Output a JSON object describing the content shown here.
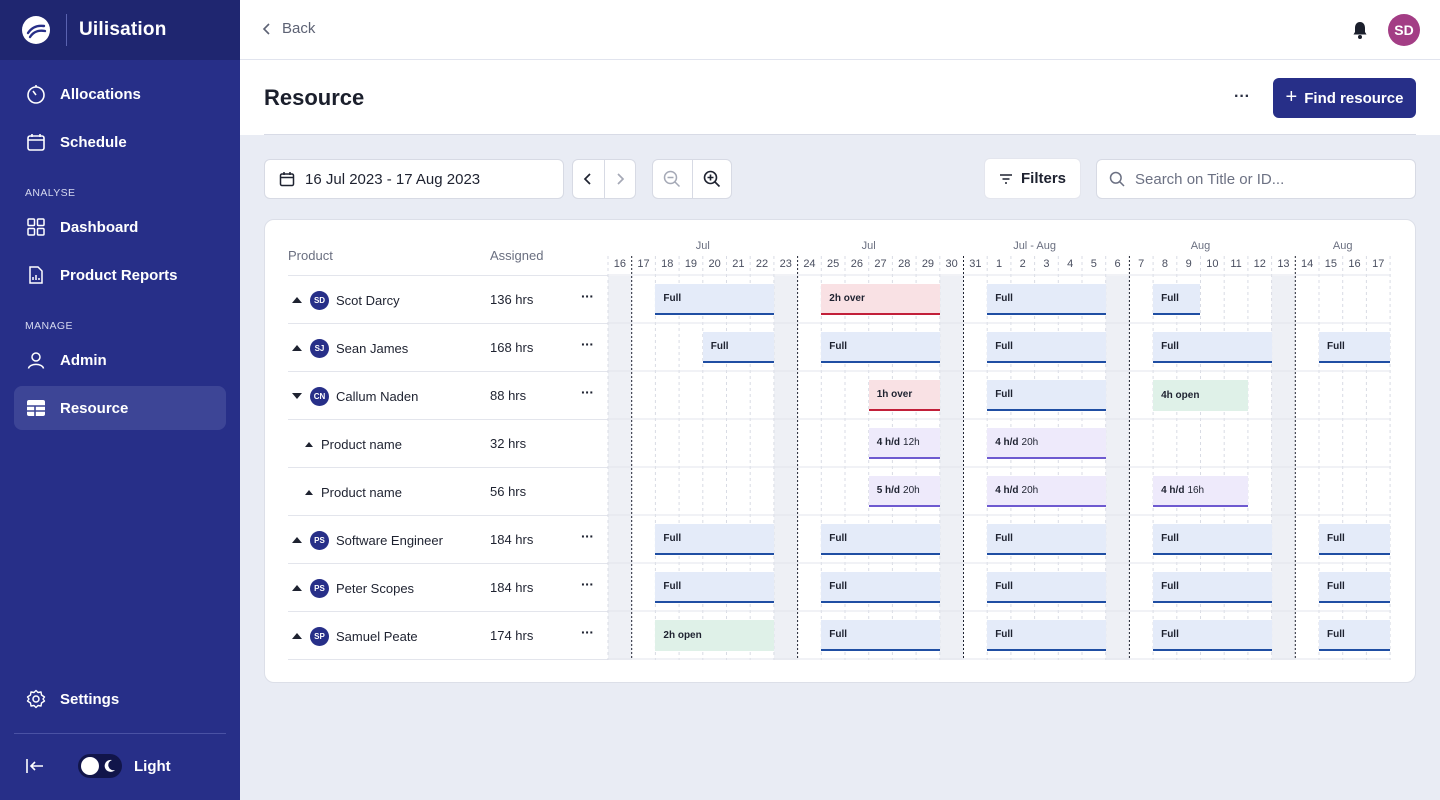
{
  "app": {
    "name": "Uilisation"
  },
  "sidebar": {
    "items_top": [
      {
        "label": "Allocations",
        "icon": "timer-icon"
      },
      {
        "label": "Schedule",
        "icon": "calendar-icon"
      }
    ],
    "section_analyse": "ANALYSE",
    "items_analyse": [
      {
        "label": "Dashboard",
        "icon": "grid-icon"
      },
      {
        "label": "Product Reports",
        "icon": "report-icon"
      }
    ],
    "section_manage": "MANAGE",
    "items_manage": [
      {
        "label": "Admin",
        "icon": "user-icon"
      },
      {
        "label": "Resource",
        "icon": "table-icon",
        "active": true
      }
    ],
    "settings": "Settings",
    "theme_label": "Light"
  },
  "topbar": {
    "back_label": "Back",
    "avatar_initials": "SD"
  },
  "header": {
    "title": "Resource",
    "more": "···",
    "find_button": "Find resource",
    "find_plus": "+"
  },
  "toolbar": {
    "date_range": "16 Jul 2023 - 17 Aug 2023",
    "filters_label": "Filters",
    "search_placeholder": "Search on Title or ID..."
  },
  "table": {
    "col_product": "Product",
    "col_assigned": "Assigned",
    "row_menu": "···",
    "rows": [
      {
        "name": "Scot Darcy",
        "initials": "SD",
        "hours": "136 hrs",
        "type": "person",
        "caret": "up"
      },
      {
        "name": "Sean James",
        "initials": "SJ",
        "hours": "168 hrs",
        "type": "person",
        "caret": "up"
      },
      {
        "name": "Callum Naden",
        "initials": "CN",
        "hours": "88 hrs",
        "type": "person",
        "caret": "down"
      },
      {
        "name": "Product name",
        "hours": "32 hrs",
        "type": "product"
      },
      {
        "name": "Product name",
        "hours": "56 hrs",
        "type": "product"
      },
      {
        "name": "Software Engineer",
        "initials": "PS",
        "hours": "184 hrs",
        "type": "person",
        "caret": "up"
      },
      {
        "name": "Peter Scopes",
        "initials": "PS",
        "hours": "184 hrs",
        "type": "person",
        "caret": "up"
      },
      {
        "name": "Samuel Peate",
        "initials": "SP",
        "hours": "174 hrs",
        "type": "person",
        "caret": "up"
      }
    ]
  },
  "gantt": {
    "days": [
      "16",
      "17",
      "18",
      "19",
      "20",
      "21",
      "22",
      "23",
      "24",
      "25",
      "26",
      "27",
      "28",
      "29",
      "30",
      "31",
      "1",
      "2",
      "3",
      "4",
      "5",
      "6",
      "7",
      "8",
      "9",
      "10",
      "11",
      "12",
      "13",
      "14",
      "15",
      "16",
      "17"
    ],
    "weekend_days": [
      0,
      7,
      14,
      21,
      28
    ],
    "week_separators": [
      1,
      8,
      15,
      22,
      29
    ],
    "months": [
      {
        "label": "Jul",
        "day": 4
      },
      {
        "label": "Jul",
        "day": 11
      },
      {
        "label": "Jul - Aug",
        "day": 18
      },
      {
        "label": "Aug",
        "day": 25
      },
      {
        "label": "Aug",
        "day": 31
      }
    ],
    "bars": [
      {
        "row": 0,
        "start": 2,
        "end": 7,
        "label": "Full",
        "color": "blue"
      },
      {
        "row": 0,
        "start": 9,
        "end": 14,
        "label": "2h over",
        "color": "red"
      },
      {
        "row": 0,
        "start": 16,
        "end": 21,
        "label": "Full",
        "color": "blue"
      },
      {
        "row": 0,
        "start": 23,
        "end": 25,
        "label": "Full",
        "color": "blue"
      },
      {
        "row": 1,
        "start": 4,
        "end": 7,
        "label": "Full",
        "color": "blue"
      },
      {
        "row": 1,
        "start": 9,
        "end": 14,
        "label": "Full",
        "color": "blue"
      },
      {
        "row": 1,
        "start": 16,
        "end": 21,
        "label": "Full",
        "color": "blue"
      },
      {
        "row": 1,
        "start": 23,
        "end": 28,
        "label": "Full",
        "color": "blue"
      },
      {
        "row": 1,
        "start": 30,
        "end": 33,
        "label": "Full",
        "color": "blue"
      },
      {
        "row": 2,
        "start": 11,
        "end": 14,
        "label": "1h over",
        "color": "red"
      },
      {
        "row": 2,
        "start": 16,
        "end": 21,
        "label": "Full",
        "color": "blue"
      },
      {
        "row": 2,
        "start": 23,
        "end": 27,
        "label": "4h open",
        "color": "green"
      },
      {
        "row": 3,
        "start": 11,
        "end": 14,
        "label": "4 h/d",
        "sub": "12h",
        "color": "purple"
      },
      {
        "row": 3,
        "start": 16,
        "end": 21,
        "label": "4 h/d",
        "sub": "20h",
        "color": "purple"
      },
      {
        "row": 4,
        "start": 11,
        "end": 14,
        "label": "5 h/d",
        "sub": "20h",
        "color": "purple"
      },
      {
        "row": 4,
        "start": 16,
        "end": 21,
        "label": "4 h/d",
        "sub": "20h",
        "color": "purple"
      },
      {
        "row": 4,
        "start": 23,
        "end": 27,
        "label": "4 h/d",
        "sub": "16h",
        "color": "purple"
      },
      {
        "row": 5,
        "start": 2,
        "end": 7,
        "label": "Full",
        "color": "blue"
      },
      {
        "row": 5,
        "start": 9,
        "end": 14,
        "label": "Full",
        "color": "blue"
      },
      {
        "row": 5,
        "start": 16,
        "end": 21,
        "label": "Full",
        "color": "blue"
      },
      {
        "row": 5,
        "start": 23,
        "end": 28,
        "label": "Full",
        "color": "blue"
      },
      {
        "row": 5,
        "start": 30,
        "end": 33,
        "label": "Full",
        "color": "blue"
      },
      {
        "row": 6,
        "start": 2,
        "end": 7,
        "label": "Full",
        "color": "blue"
      },
      {
        "row": 6,
        "start": 9,
        "end": 14,
        "label": "Full",
        "color": "blue"
      },
      {
        "row": 6,
        "start": 16,
        "end": 21,
        "label": "Full",
        "color": "blue"
      },
      {
        "row": 6,
        "start": 23,
        "end": 28,
        "label": "Full",
        "color": "blue"
      },
      {
        "row": 6,
        "start": 30,
        "end": 33,
        "label": "Full",
        "color": "blue"
      },
      {
        "row": 7,
        "start": 2,
        "end": 7,
        "label": "2h open",
        "color": "green"
      },
      {
        "row": 7,
        "start": 9,
        "end": 14,
        "label": "Full",
        "color": "blue"
      },
      {
        "row": 7,
        "start": 16,
        "end": 21,
        "label": "Full",
        "color": "blue"
      },
      {
        "row": 7,
        "start": 23,
        "end": 28,
        "label": "Full",
        "color": "blue"
      },
      {
        "row": 7,
        "start": 30,
        "end": 33,
        "label": "Full",
        "color": "blue"
      }
    ]
  },
  "colors": {
    "sidebar": "#272f88",
    "accent": "#272f88",
    "full": "#1f4ea3",
    "over": "#c21f39",
    "open": "#dff1e8",
    "product": "#6e5ad0"
  }
}
